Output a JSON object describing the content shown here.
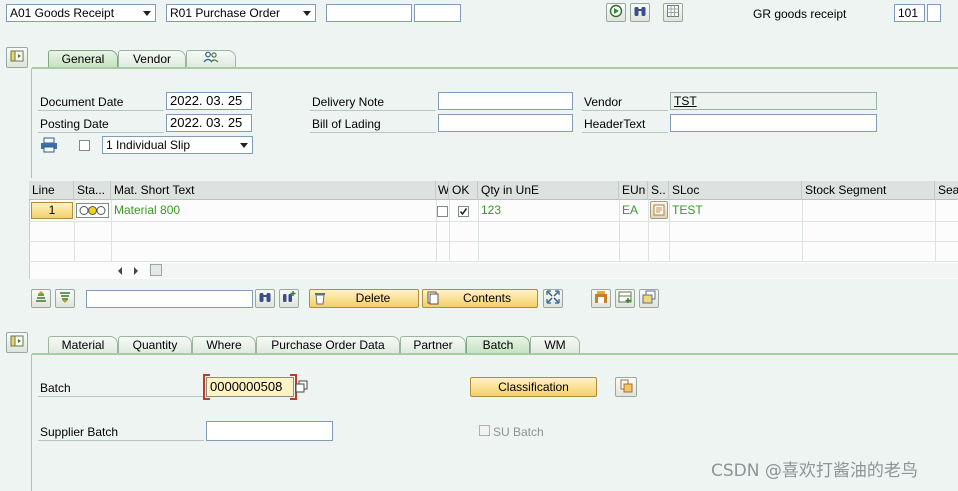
{
  "top_bar": {
    "action_select": "A01 Goods Receipt",
    "reference_select": "R01 Purchase Order",
    "field1": "",
    "field2": "",
    "movement_label": "GR goods receipt",
    "movement_type": "101",
    "movement_extra": ""
  },
  "header_tabs": [
    {
      "label": "General"
    },
    {
      "label": "Vendor"
    },
    {
      "label": ""
    }
  ],
  "header": {
    "document_date_label": "Document Date",
    "document_date": "2022. 03. 25",
    "posting_date_label": "Posting Date",
    "posting_date": "2022. 03. 25",
    "delivery_note_label": "Delivery Note",
    "delivery_note": "",
    "bill_of_lading_label": "Bill of Lading",
    "bill_of_lading": "",
    "vendor_label": "Vendor",
    "vendor": "TST",
    "header_text_label": "HeaderText",
    "header_text": "",
    "print_select": "1 Individual Slip"
  },
  "grid": {
    "columns": [
      "Line",
      "Sta...",
      "Mat. Short Text",
      "W",
      "OK",
      "Qty in UnE",
      "EUn",
      "S..",
      "SLoc",
      "Stock Segment",
      "Sea"
    ],
    "rows": [
      {
        "line": "1",
        "material": "Material 800",
        "ok": true,
        "qty": "123",
        "eun": "EA",
        "sloc": "TEST"
      }
    ]
  },
  "toolbar2": {
    "search_value": "",
    "delete_label": "Delete",
    "contents_label": "Contents"
  },
  "item_tabs": [
    {
      "label": "Material"
    },
    {
      "label": "Quantity"
    },
    {
      "label": "Where"
    },
    {
      "label": "Purchase Order Data"
    },
    {
      "label": "Partner"
    },
    {
      "label": "Batch"
    },
    {
      "label": "WM"
    }
  ],
  "batch_tab": {
    "batch_label": "Batch",
    "batch_value": "0000000508",
    "classification_label": "Classification",
    "supplier_batch_label": "Supplier Batch",
    "supplier_batch_value": "",
    "su_batch_label": "SU Batch"
  },
  "watermark": "CSDN @喜欢打酱油的老鸟",
  "colors": {
    "background": "#eef4f2",
    "active_tab": "#c7e2c2",
    "accent_green": "#3a9a23",
    "button_gold": "#f3cf6a",
    "batch_highlight": "#c0392b"
  }
}
